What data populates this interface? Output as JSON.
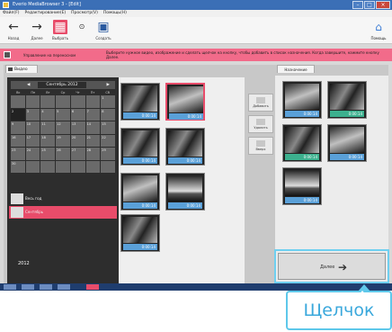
{
  "window": {
    "title": "Everio MediaBrowser 3 - [Edit]"
  },
  "menu": [
    "Файл(F)",
    "Редактирование(E)",
    "Просмотр(V)",
    "Помощь(H)"
  ],
  "toolbar": [
    {
      "label": "Назад",
      "icon": "arrow-left-icon"
    },
    {
      "label": "Далее",
      "icon": "arrow-right-icon"
    },
    {
      "label": "Выбрать",
      "icon": "select-grid-icon"
    },
    {
      "label": "",
      "icon": "dot-icon"
    },
    {
      "label": "Создать",
      "icon": "save-disk-icon"
    }
  ],
  "help": {
    "label": "Помощь"
  },
  "message": {
    "mode": "Управление на переносном",
    "text": "Выберите нужное видео, изображение и сделать щелчок на кнопку, чтобы добавить в список назначения. Когда завершите, нажмите кнопку Далее."
  },
  "tabs": {
    "left": "Видео",
    "right": "Назначение"
  },
  "calendar": {
    "month": "Сентябрь 2012",
    "weekdays": [
      "Вс",
      "Пн",
      "Вт",
      "Ср",
      "Чт",
      "Пт",
      "Сб"
    ],
    "days": [
      "",
      "",
      "",
      "",
      "",
      "",
      "1",
      "2",
      "3",
      "4",
      "5",
      "6",
      "7",
      "8",
      "9",
      "10",
      "11",
      "12",
      "13",
      "14",
      "15",
      "16",
      "17",
      "18",
      "19",
      "20",
      "21",
      "22",
      "23",
      "24",
      "25",
      "26",
      "27",
      "28",
      "29",
      "30",
      "",
      "",
      "",
      "",
      "",
      ""
    ]
  },
  "year": "2012",
  "videolist": [
    "Весь год",
    "Сентябрь"
  ],
  "source_clips": [
    {
      "duration": "0:00:14",
      "selected": false
    },
    {
      "duration": "0:00:14",
      "selected": true
    },
    {
      "duration": "0:00:14",
      "selected": false
    },
    {
      "duration": "0:00:14",
      "selected": false
    },
    {
      "duration": "0:00:14",
      "selected": false
    },
    {
      "duration": "0:00:14",
      "selected": false
    },
    {
      "duration": "0:00:14",
      "selected": false
    }
  ],
  "dest_clips": [
    {
      "duration": "0:00:14",
      "color": "blue"
    },
    {
      "duration": "0:00:14",
      "color": "green"
    },
    {
      "duration": "0:00:14",
      "color": "green"
    },
    {
      "duration": "0:00:14",
      "color": "blue"
    },
    {
      "duration": "0:00:14",
      "color": "blue"
    }
  ],
  "midbuttons": [
    "Добавить",
    "Удалить",
    "Вверх"
  ],
  "next": {
    "label": "Далее"
  },
  "callout": {
    "text": "Щелчок"
  },
  "colors": {
    "accent": "#e84c6a",
    "callout": "#5ec8ea",
    "label_blue": "#5aa0d8",
    "label_green": "#3cb08e"
  }
}
